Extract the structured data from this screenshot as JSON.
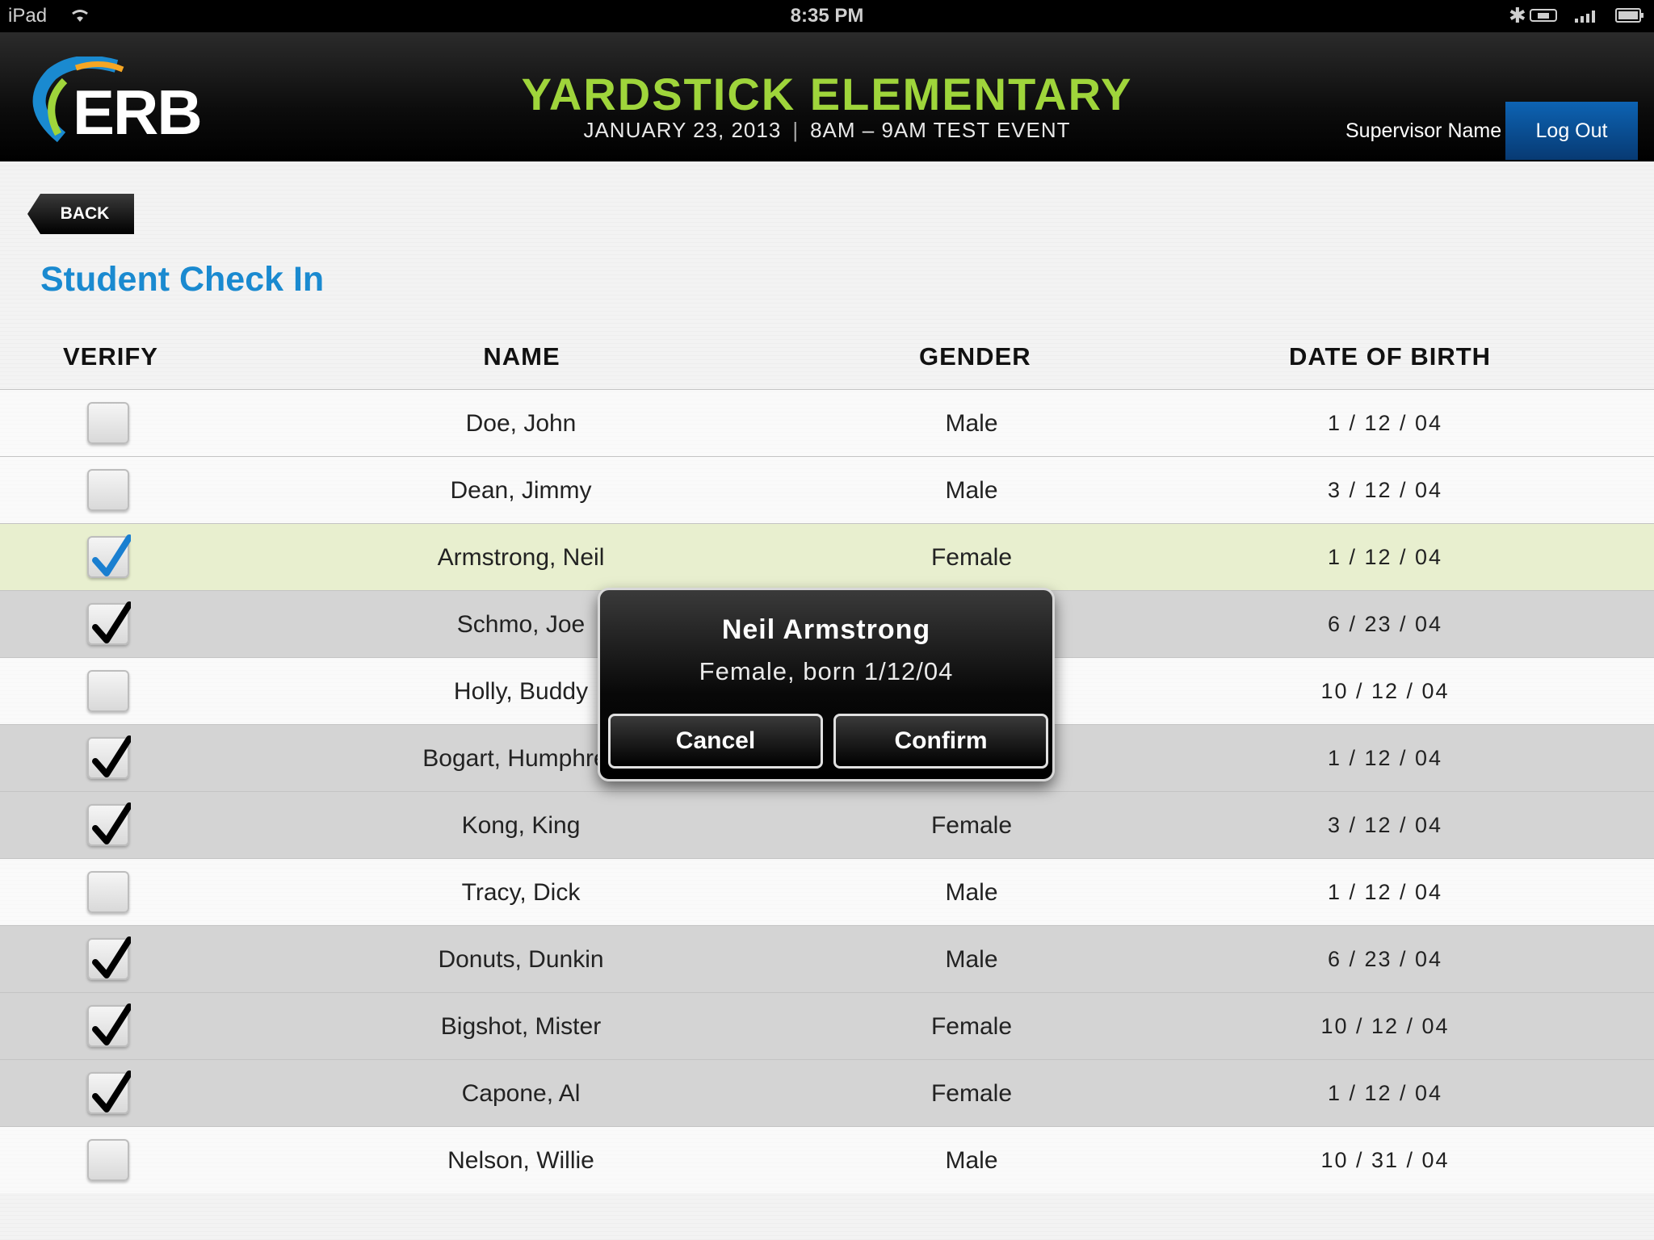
{
  "status_bar": {
    "device": "iPad",
    "time": "8:35 PM"
  },
  "header": {
    "logo_text": "ERB",
    "school": "YARDSTICK ELEMENTARY",
    "event_date": "JANUARY 23, 2013",
    "event_separator": "|",
    "event_name": "8AM – 9AM TEST EVENT",
    "supervisor": "Supervisor Name",
    "logout_label": "Log Out"
  },
  "back_label": "BACK",
  "page_title": "Student Check In",
  "table": {
    "headers": {
      "verify": "VERIFY",
      "name": "NAME",
      "gender": "GENDER",
      "dob": "DATE OF BIRTH"
    },
    "rows": [
      {
        "name": "Doe, John",
        "gender": "Male",
        "dob": "1 / 12 / 04",
        "checked": false,
        "style": "white"
      },
      {
        "name": "Dean, Jimmy",
        "gender": "Male",
        "dob": "3 / 12 / 04",
        "checked": false,
        "style": "white"
      },
      {
        "name": "Armstrong, Neil",
        "gender": "Female",
        "dob": "1 / 12 / 04",
        "checked": true,
        "style": "selected"
      },
      {
        "name": "Schmo, Joe",
        "gender": "",
        "dob": "6 / 23 / 04",
        "checked": true,
        "style": "gray"
      },
      {
        "name": "Holly, Buddy",
        "gender": "",
        "dob": "10 / 12 / 04",
        "checked": false,
        "style": "white"
      },
      {
        "name": "Bogart, Humphrey",
        "gender": "",
        "dob": "1 / 12 / 04",
        "checked": true,
        "style": "gray"
      },
      {
        "name": "Kong, King",
        "gender": "Female",
        "dob": "3 / 12 / 04",
        "checked": true,
        "style": "gray"
      },
      {
        "name": "Tracy, Dick",
        "gender": "Male",
        "dob": "1 / 12 / 04",
        "checked": false,
        "style": "white"
      },
      {
        "name": "Donuts, Dunkin",
        "gender": "Male",
        "dob": "6 / 23 / 04",
        "checked": true,
        "style": "gray"
      },
      {
        "name": "Bigshot, Mister",
        "gender": "Female",
        "dob": "10 / 12 / 04",
        "checked": true,
        "style": "gray"
      },
      {
        "name": "Capone, Al",
        "gender": "Female",
        "dob": "1 / 12 / 04",
        "checked": true,
        "style": "gray"
      },
      {
        "name": "Nelson, Willie",
        "gender": "Male",
        "dob": "10 / 31 / 04",
        "checked": false,
        "style": "white"
      }
    ]
  },
  "modal": {
    "name": "Neil Armstrong",
    "details": "Female, born 1/12/04",
    "cancel_label": "Cancel",
    "confirm_label": "Confirm"
  },
  "colors": {
    "title_green": "#9fd53b",
    "page_title_blue": "#1a8ad0",
    "logout_blue": "#0d63b3",
    "selected_row": "#e8efcf",
    "checked_row": "#d4d4d4",
    "check_blue": "#1a7fd0"
  }
}
